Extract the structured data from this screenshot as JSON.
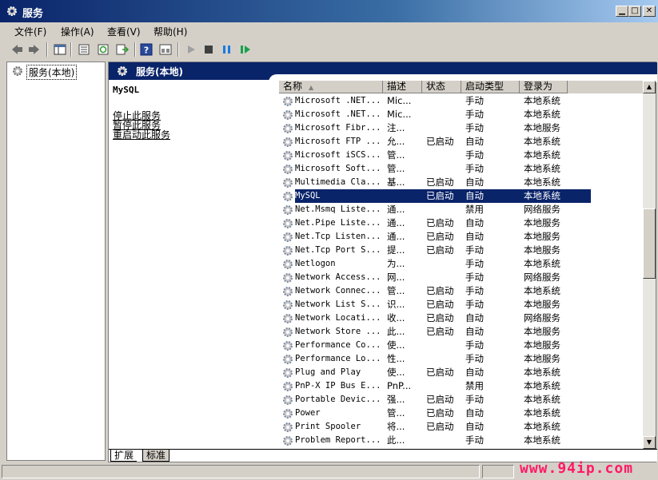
{
  "window": {
    "title": "服务"
  },
  "menu": [
    "文件(F)",
    "操作(A)",
    "查看(V)",
    "帮助(H)"
  ],
  "tree": {
    "root_label": "服务(本地)"
  },
  "pane": {
    "title": "服务(本地)"
  },
  "details": {
    "service_name": "MySQL",
    "links": [
      "停止此服务",
      "暂停此服务",
      "重启动此服务"
    ]
  },
  "columns": [
    "名称",
    "描述",
    "状态",
    "启动类型",
    "登录为"
  ],
  "services": [
    {
      "name": "Microsoft .NET...",
      "desc": "Mic...",
      "status": "",
      "startup": "手动",
      "logon": "本地系统"
    },
    {
      "name": "Microsoft .NET...",
      "desc": "Mic...",
      "status": "",
      "startup": "手动",
      "logon": "本地系统"
    },
    {
      "name": "Microsoft Fibr...",
      "desc": "注...",
      "status": "",
      "startup": "手动",
      "logon": "本地服务"
    },
    {
      "name": "Microsoft FTP ...",
      "desc": "允...",
      "status": "已启动",
      "startup": "自动",
      "logon": "本地系统"
    },
    {
      "name": "Microsoft iSCS...",
      "desc": "管...",
      "status": "",
      "startup": "手动",
      "logon": "本地系统"
    },
    {
      "name": "Microsoft Soft...",
      "desc": "管...",
      "status": "",
      "startup": "手动",
      "logon": "本地系统"
    },
    {
      "name": "Multimedia Cla...",
      "desc": "基...",
      "status": "已启动",
      "startup": "自动",
      "logon": "本地系统"
    },
    {
      "name": "MySQL",
      "desc": "",
      "status": "已启动",
      "startup": "自动",
      "logon": "本地系统",
      "selected": true
    },
    {
      "name": "Net.Msmq Liste...",
      "desc": "通...",
      "status": "",
      "startup": "禁用",
      "logon": "网络服务"
    },
    {
      "name": "Net.Pipe Liste...",
      "desc": "通...",
      "status": "已启动",
      "startup": "自动",
      "logon": "本地服务"
    },
    {
      "name": "Net.Tcp Listen...",
      "desc": "通...",
      "status": "已启动",
      "startup": "自动",
      "logon": "本地服务"
    },
    {
      "name": "Net.Tcp Port S...",
      "desc": "提...",
      "status": "已启动",
      "startup": "手动",
      "logon": "本地服务"
    },
    {
      "name": "Netlogon",
      "desc": "为...",
      "status": "",
      "startup": "手动",
      "logon": "本地系统"
    },
    {
      "name": "Network Access...",
      "desc": "网...",
      "status": "",
      "startup": "手动",
      "logon": "网络服务"
    },
    {
      "name": "Network Connec...",
      "desc": "管...",
      "status": "已启动",
      "startup": "手动",
      "logon": "本地系统"
    },
    {
      "name": "Network List S...",
      "desc": "识...",
      "status": "已启动",
      "startup": "手动",
      "logon": "本地服务"
    },
    {
      "name": "Network Locati...",
      "desc": "收...",
      "status": "已启动",
      "startup": "自动",
      "logon": "网络服务"
    },
    {
      "name": "Network Store ...",
      "desc": "此...",
      "status": "已启动",
      "startup": "自动",
      "logon": "本地服务"
    },
    {
      "name": "Performance Co...",
      "desc": "使...",
      "status": "",
      "startup": "手动",
      "logon": "本地服务"
    },
    {
      "name": "Performance Lo...",
      "desc": "性...",
      "status": "",
      "startup": "手动",
      "logon": "本地服务"
    },
    {
      "name": "Plug and Play",
      "desc": "使...",
      "status": "已启动",
      "startup": "自动",
      "logon": "本地系统"
    },
    {
      "name": "PnP-X IP Bus E...",
      "desc": "PnP...",
      "status": "",
      "startup": "禁用",
      "logon": "本地系统"
    },
    {
      "name": "Portable Devic...",
      "desc": "强...",
      "status": "已启动",
      "startup": "手动",
      "logon": "本地系统"
    },
    {
      "name": "Power",
      "desc": "管...",
      "status": "已启动",
      "startup": "自动",
      "logon": "本地系统"
    },
    {
      "name": "Print Spooler",
      "desc": "将...",
      "status": "已启动",
      "startup": "自动",
      "logon": "本地系统"
    },
    {
      "name": "Problem Report...",
      "desc": "此...",
      "status": "",
      "startup": "手动",
      "logon": "本地系统"
    }
  ],
  "tabs": [
    "扩展",
    "标准"
  ],
  "watermark": "www.94ip.com",
  "colors": {
    "title_bar": "#0a246a",
    "selection": "#0a246a",
    "watermark": "#ff1a66"
  },
  "icons": [
    "gear-icon",
    "back-icon",
    "forward-icon",
    "play-icon",
    "stop-icon",
    "pause-icon",
    "resume-icon",
    "help-icon",
    "refresh-icon",
    "export-icon"
  ]
}
